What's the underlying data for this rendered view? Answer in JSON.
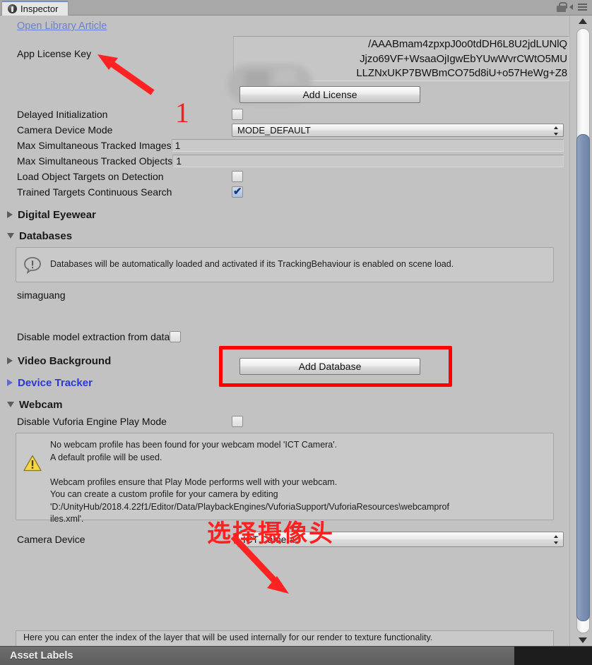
{
  "window": {
    "tab_label": "Inspector",
    "tab_icon": "inspector-icon",
    "lock_icon": "lock-icon",
    "menu_icon": "hamburger-menu-icon"
  },
  "library_link": "Open Library Article",
  "license": {
    "label": "App License Key",
    "value_line1": "/AAABmam4zpxpJ0o0tdDH6L8U2jdLUNlQ",
    "value_line2": "Jjzo69VF+WsaaOjIgwEbYUwWvrCWtO5MU",
    "value_line3": "LLZNxUKP7BWBmCO75d8iU+o57HeWg+Z8",
    "add_button": "Add License"
  },
  "fields": {
    "delayed_initialization": {
      "label": "Delayed Initialization",
      "checked": false
    },
    "camera_device_mode": {
      "label": "Camera Device Mode",
      "value": "MODE_DEFAULT"
    },
    "max_tracked_images": {
      "label": "Max Simultaneous Tracked Images",
      "value": "1"
    },
    "max_tracked_objects": {
      "label": "Max Simultaneous Tracked Objects",
      "value": "1"
    },
    "load_object_targets": {
      "label": "Load Object Targets on Detection",
      "checked": false
    },
    "trained_targets_search": {
      "label": "Trained Targets Continuous Search",
      "checked": true
    }
  },
  "sections": {
    "digital_eyewear": {
      "label": "Digital Eyewear",
      "expanded": false
    },
    "databases": {
      "label": "Databases",
      "expanded": true
    },
    "video_background": {
      "label": "Video Background",
      "expanded": false
    },
    "device_tracker": {
      "label": "Device Tracker",
      "expanded": false
    },
    "webcam": {
      "label": "Webcam",
      "expanded": true
    }
  },
  "databases": {
    "info_text": "Databases will be automatically loaded and activated if its TrackingBehaviour is enabled on scene load.",
    "info_icon": "info-icon",
    "entry_name": "simaguang",
    "add_button": "Add Database",
    "disable_extraction": {
      "label": "Disable model extraction from data",
      "checked": false
    }
  },
  "webcam": {
    "disable_play_mode": {
      "label": "Disable Vuforia Engine Play Mode",
      "checked": false
    },
    "warn_icon": "warning-icon",
    "warn_line1": "No webcam profile has been found for your webcam model 'ICT Camera'.",
    "warn_line2": "A default profile will be used.",
    "warn_line3": "Webcam profiles ensure that Play Mode performs well with your webcam.",
    "warn_line4": "You can create a custom profile for your camera by editing",
    "warn_line5": "'D:/UnityHub/2018.4.22f1/Editor/Data/PlaybackEngines/VuforiaSupport/VuforiaResources\\webcamprof",
    "warn_line6": "iles.xml'.",
    "camera_device": {
      "label": "Camera Device",
      "value": "ICT Camera"
    },
    "bottom_info": "Here you can enter the index of the layer that will be used internally for our render to texture functionality."
  },
  "annotations": {
    "step_number": "1",
    "chinese_note": "选择摄像头",
    "highlight_color": "#fe0000",
    "arrow_color": "#fe2222"
  },
  "footer": {
    "asset_labels": "Asset Labels"
  },
  "scrollbar": {
    "up_arrow": "scroll-up-arrow",
    "down_arrow": "scroll-down-arrow"
  }
}
